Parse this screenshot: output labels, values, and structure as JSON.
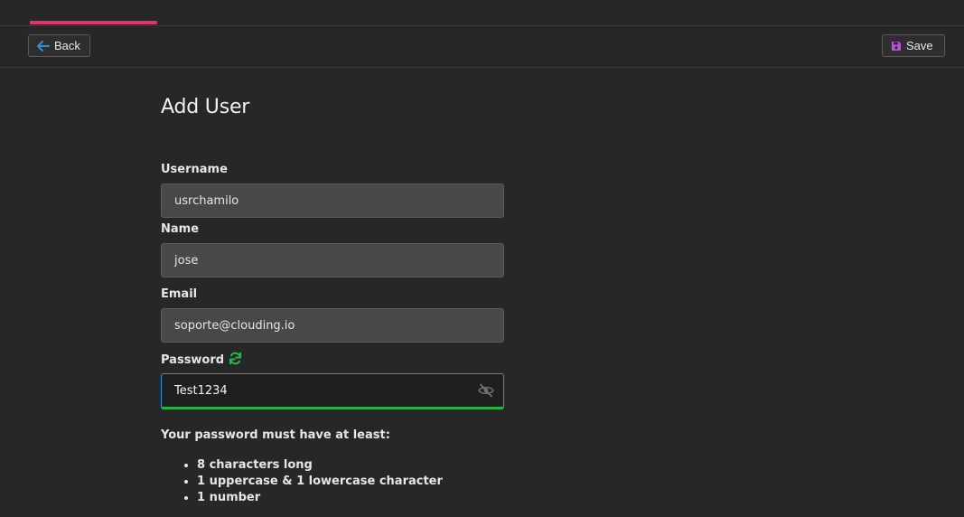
{
  "progress": {
    "fraction": 0.132,
    "color": "#e0356b"
  },
  "toolbar": {
    "back_label": "Back",
    "save_label": "Save",
    "back_icon": "arrow-left-icon",
    "save_icon": "floppy-disk-icon",
    "back_icon_color": "#2d8fd6",
    "save_icon_color": "#c04ee0"
  },
  "form": {
    "title": "Add User",
    "username": {
      "label": "Username",
      "value": "usrchamilo"
    },
    "name": {
      "label": "Name",
      "value": "jose"
    },
    "email": {
      "label": "Email",
      "value": "soporte@clouding.io"
    },
    "password": {
      "label": "Password",
      "value": "Test1234",
      "regenerate_icon": "refresh-icon",
      "visibility_icon": "eye-slash-icon",
      "strength_color": "#2bb34a"
    }
  },
  "rules": {
    "title": "Your password must have at least:",
    "items": [
      "8 characters long",
      "1 uppercase & 1 lowercase character",
      "1 number"
    ]
  }
}
